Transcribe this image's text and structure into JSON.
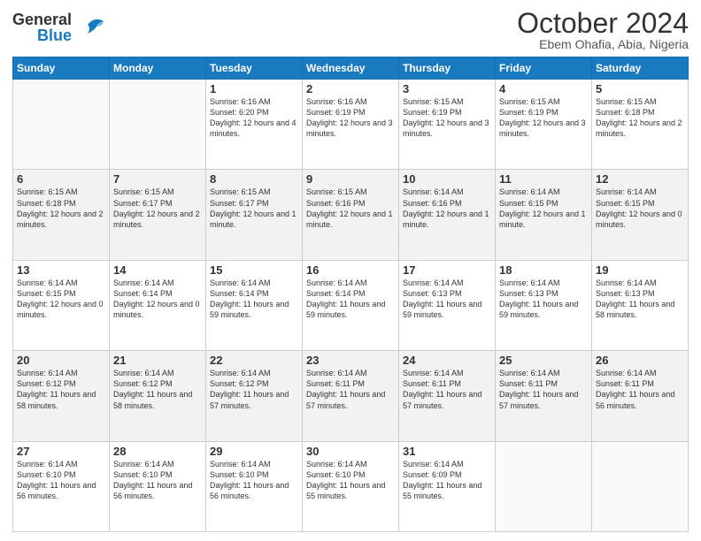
{
  "header": {
    "logo_line1": "General",
    "logo_line2": "Blue",
    "title": "October 2024",
    "subtitle": "Ebem Ohafia, Abia, Nigeria"
  },
  "days_of_week": [
    "Sunday",
    "Monday",
    "Tuesday",
    "Wednesday",
    "Thursday",
    "Friday",
    "Saturday"
  ],
  "weeks": [
    [
      {
        "day": "",
        "info": ""
      },
      {
        "day": "",
        "info": ""
      },
      {
        "day": "1",
        "info": "Sunrise: 6:16 AM\nSunset: 6:20 PM\nDaylight: 12 hours and 4 minutes."
      },
      {
        "day": "2",
        "info": "Sunrise: 6:16 AM\nSunset: 6:19 PM\nDaylight: 12 hours and 3 minutes."
      },
      {
        "day": "3",
        "info": "Sunrise: 6:15 AM\nSunset: 6:19 PM\nDaylight: 12 hours and 3 minutes."
      },
      {
        "day": "4",
        "info": "Sunrise: 6:15 AM\nSunset: 6:19 PM\nDaylight: 12 hours and 3 minutes."
      },
      {
        "day": "5",
        "info": "Sunrise: 6:15 AM\nSunset: 6:18 PM\nDaylight: 12 hours and 2 minutes."
      }
    ],
    [
      {
        "day": "6",
        "info": "Sunrise: 6:15 AM\nSunset: 6:18 PM\nDaylight: 12 hours and 2 minutes."
      },
      {
        "day": "7",
        "info": "Sunrise: 6:15 AM\nSunset: 6:17 PM\nDaylight: 12 hours and 2 minutes."
      },
      {
        "day": "8",
        "info": "Sunrise: 6:15 AM\nSunset: 6:17 PM\nDaylight: 12 hours and 1 minute."
      },
      {
        "day": "9",
        "info": "Sunrise: 6:15 AM\nSunset: 6:16 PM\nDaylight: 12 hours and 1 minute."
      },
      {
        "day": "10",
        "info": "Sunrise: 6:14 AM\nSunset: 6:16 PM\nDaylight: 12 hours and 1 minute."
      },
      {
        "day": "11",
        "info": "Sunrise: 6:14 AM\nSunset: 6:15 PM\nDaylight: 12 hours and 1 minute."
      },
      {
        "day": "12",
        "info": "Sunrise: 6:14 AM\nSunset: 6:15 PM\nDaylight: 12 hours and 0 minutes."
      }
    ],
    [
      {
        "day": "13",
        "info": "Sunrise: 6:14 AM\nSunset: 6:15 PM\nDaylight: 12 hours and 0 minutes."
      },
      {
        "day": "14",
        "info": "Sunrise: 6:14 AM\nSunset: 6:14 PM\nDaylight: 12 hours and 0 minutes."
      },
      {
        "day": "15",
        "info": "Sunrise: 6:14 AM\nSunset: 6:14 PM\nDaylight: 11 hours and 59 minutes."
      },
      {
        "day": "16",
        "info": "Sunrise: 6:14 AM\nSunset: 6:14 PM\nDaylight: 11 hours and 59 minutes."
      },
      {
        "day": "17",
        "info": "Sunrise: 6:14 AM\nSunset: 6:13 PM\nDaylight: 11 hours and 59 minutes."
      },
      {
        "day": "18",
        "info": "Sunrise: 6:14 AM\nSunset: 6:13 PM\nDaylight: 11 hours and 59 minutes."
      },
      {
        "day": "19",
        "info": "Sunrise: 6:14 AM\nSunset: 6:13 PM\nDaylight: 11 hours and 58 minutes."
      }
    ],
    [
      {
        "day": "20",
        "info": "Sunrise: 6:14 AM\nSunset: 6:12 PM\nDaylight: 11 hours and 58 minutes."
      },
      {
        "day": "21",
        "info": "Sunrise: 6:14 AM\nSunset: 6:12 PM\nDaylight: 11 hours and 58 minutes."
      },
      {
        "day": "22",
        "info": "Sunrise: 6:14 AM\nSunset: 6:12 PM\nDaylight: 11 hours and 57 minutes."
      },
      {
        "day": "23",
        "info": "Sunrise: 6:14 AM\nSunset: 6:11 PM\nDaylight: 11 hours and 57 minutes."
      },
      {
        "day": "24",
        "info": "Sunrise: 6:14 AM\nSunset: 6:11 PM\nDaylight: 11 hours and 57 minutes."
      },
      {
        "day": "25",
        "info": "Sunrise: 6:14 AM\nSunset: 6:11 PM\nDaylight: 11 hours and 57 minutes."
      },
      {
        "day": "26",
        "info": "Sunrise: 6:14 AM\nSunset: 6:11 PM\nDaylight: 11 hours and 56 minutes."
      }
    ],
    [
      {
        "day": "27",
        "info": "Sunrise: 6:14 AM\nSunset: 6:10 PM\nDaylight: 11 hours and 56 minutes."
      },
      {
        "day": "28",
        "info": "Sunrise: 6:14 AM\nSunset: 6:10 PM\nDaylight: 11 hours and 56 minutes."
      },
      {
        "day": "29",
        "info": "Sunrise: 6:14 AM\nSunset: 6:10 PM\nDaylight: 11 hours and 56 minutes."
      },
      {
        "day": "30",
        "info": "Sunrise: 6:14 AM\nSunset: 6:10 PM\nDaylight: 11 hours and 55 minutes."
      },
      {
        "day": "31",
        "info": "Sunrise: 6:14 AM\nSunset: 6:09 PM\nDaylight: 11 hours and 55 minutes."
      },
      {
        "day": "",
        "info": ""
      },
      {
        "day": "",
        "info": ""
      }
    ]
  ]
}
